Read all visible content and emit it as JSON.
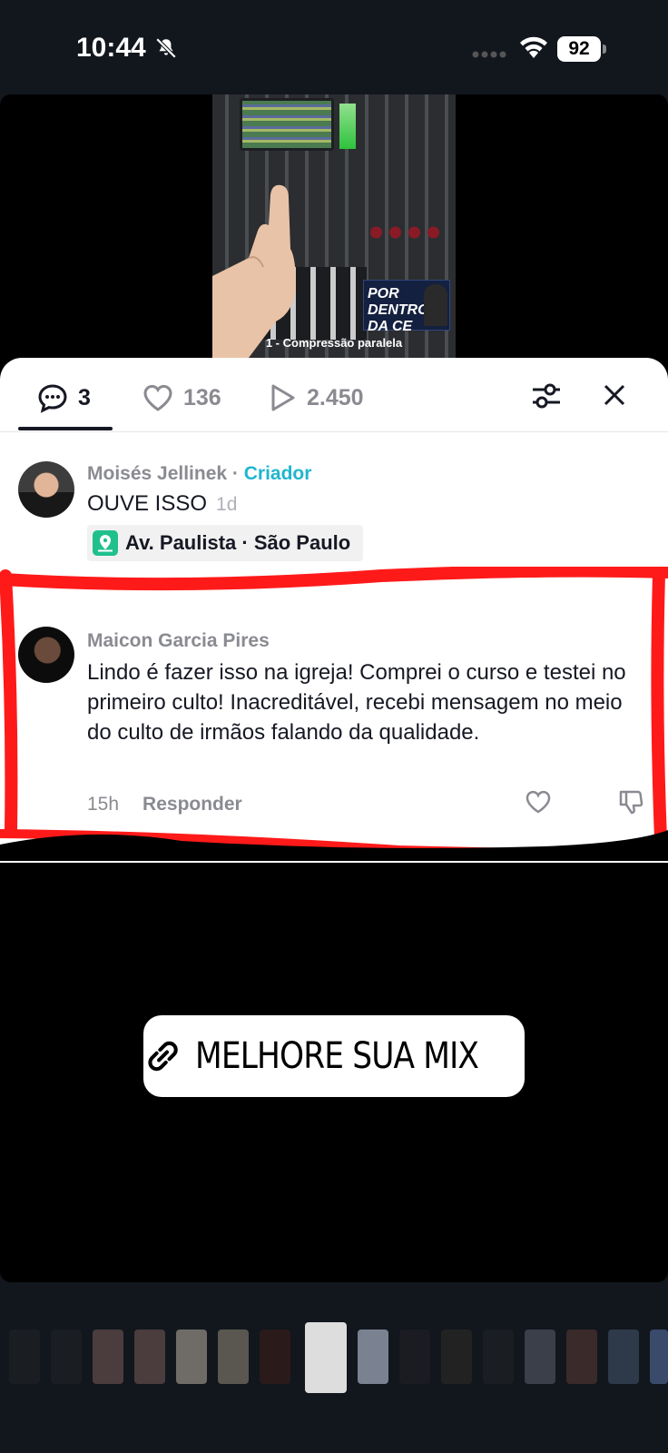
{
  "status_bar": {
    "time": "10:44",
    "battery": "92",
    "icons": [
      "bell-slash-icon",
      "cellular-dots-icon",
      "wifi-icon",
      "battery-icon"
    ]
  },
  "video": {
    "promo_text": "POR DENTRO DA CE",
    "caption": "1 - Compressão paralela"
  },
  "tabs": {
    "comments_count": "3",
    "likes_count": "136",
    "views_count": "2.450"
  },
  "comments": [
    {
      "author": "Moisés Jellinek",
      "separator": " · ",
      "badge": "Criador",
      "text": "OUVE ISSO",
      "time": "1d",
      "location": "Av. Paulista · São Paulo"
    },
    {
      "author": "Maicon Garcia Pires",
      "text": "Lindo é fazer isso na igreja! Comprei o curso e testei no primeiro culto! Inacreditável, recebi mensagem no meio do culto de irmãos falando da qualidade.",
      "time": "15h",
      "reply_label": "Responder"
    }
  ],
  "cta": {
    "label": "MELHORE SUA MIX"
  },
  "colors": {
    "accent_creator": "#20b6cf",
    "highlight": "#ff1a1a",
    "location_icon": "#20c08d"
  }
}
